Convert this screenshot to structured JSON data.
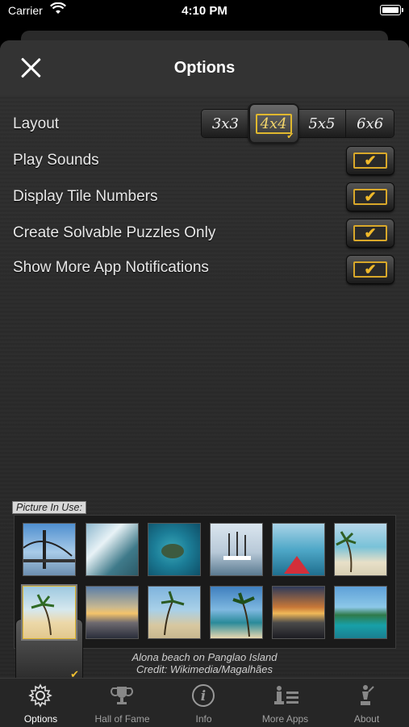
{
  "status": {
    "carrier": "Carrier",
    "time": "4:10 PM"
  },
  "nav": {
    "title": "Options"
  },
  "options": {
    "layout_label": "Layout",
    "layout_options": [
      "3x3",
      "4x4",
      "5x5",
      "6x6"
    ],
    "layout_selected": "4x4",
    "toggles": [
      {
        "label": "Play Sounds",
        "checked": true
      },
      {
        "label": "Display Tile Numbers",
        "checked": true
      },
      {
        "label": "Create Solvable Puzzles Only",
        "checked": true
      },
      {
        "label": "Show More App Notifications",
        "checked": true
      }
    ]
  },
  "picture": {
    "label": "Picture In Use:",
    "caption_line1": "Alona beach on Panglao Island",
    "caption_line2": "Credit: Wikimedia/Magalhães",
    "selected_index": 6
  },
  "tabs": [
    {
      "label": "Hall of Fame",
      "icon": "trophy-icon"
    },
    {
      "label": "Options",
      "icon": "gear-icon"
    },
    {
      "label": "Info",
      "icon": "info-icon"
    },
    {
      "label": "More Apps",
      "icon": "more-apps-icon"
    },
    {
      "label": "About",
      "icon": "about-icon"
    }
  ],
  "colors": {
    "accent": "#e0b82e",
    "background": "#2b2b2b"
  }
}
